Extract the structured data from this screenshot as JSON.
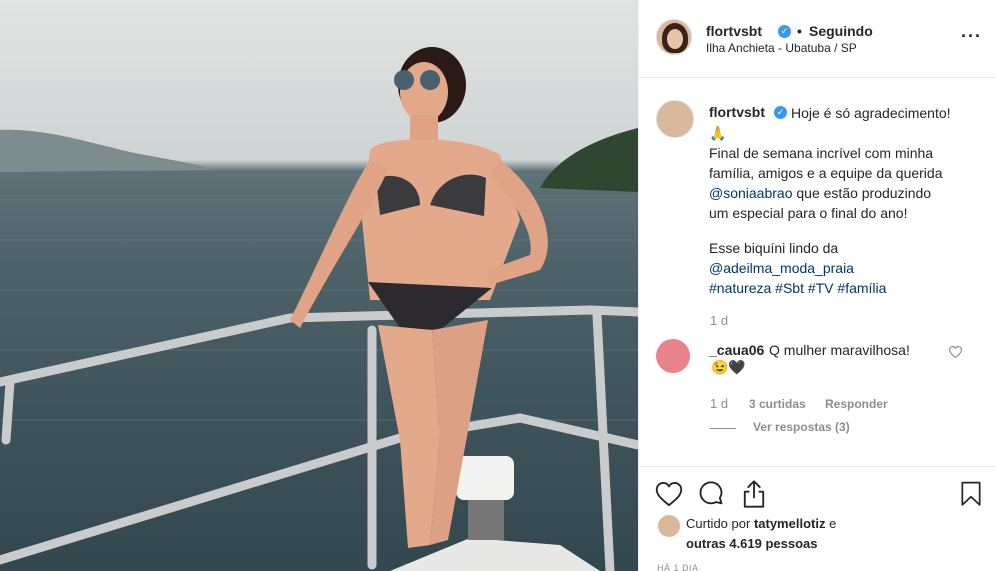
{
  "header": {
    "username": "flortvsbt",
    "separator": "•",
    "follow_status": "Seguindo",
    "location": "Ilha Anchieta - Ubatuba / SP",
    "more_icon": "more-options-icon"
  },
  "caption": {
    "username": "flortvsbt",
    "lines": {
      "l1": "Hoje é só agradecimento!",
      "l2": "🙏",
      "l3": "Final de semana incrível com minha",
      "l4": "família, amigos e a equipe da querida",
      "l5_mention": "@soniaabrao",
      "l5_rest": " que estão produzindo",
      "l6": "um especial para o final do ano!",
      "l7": "Esse biquíni lindo da",
      "l8_mention": "@adeilma_moda_praia",
      "l9_tags": "#natureza #Sbt #TV #família"
    },
    "time": "1 d"
  },
  "comment": {
    "username": "_caua06",
    "text": "Q mulher maravilhosa!",
    "emoji": "😉🖤",
    "time": "1 d",
    "likes": "3 curtidas",
    "reply": "Responder",
    "view_replies": "Ver respostas (3)"
  },
  "likes": {
    "prefix": "Curtido por",
    "user": "tatymellotiz",
    "suffix": "e",
    "others": "outras 4.619 pessoas"
  },
  "date": "HÁ 1 DIA",
  "colors": {
    "verified": "#3897f0",
    "link": "#003569",
    "muted": "#8e8e8e",
    "comment_avatar": "#e8838b"
  }
}
